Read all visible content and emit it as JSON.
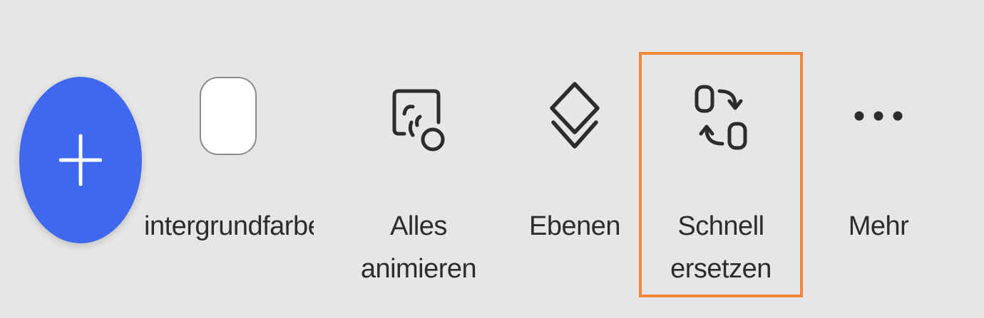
{
  "toolbar": {
    "add_button": {
      "icon": "plus-icon",
      "color": "#3f68ee"
    },
    "items": [
      {
        "label": "intergrundfarbe",
        "icon": "background-color-swatch",
        "swatch_color": "#ffffff"
      },
      {
        "label": "Alles\nanimieren",
        "icon": "animate-all-icon"
      },
      {
        "label": "Ebenen",
        "icon": "layers-icon"
      },
      {
        "label": "Schnell\nersetzen",
        "icon": "quick-replace-icon",
        "highlighted": true
      },
      {
        "label": "Mehr",
        "icon": "more-icon"
      }
    ],
    "highlight_color": "#f0873a"
  }
}
